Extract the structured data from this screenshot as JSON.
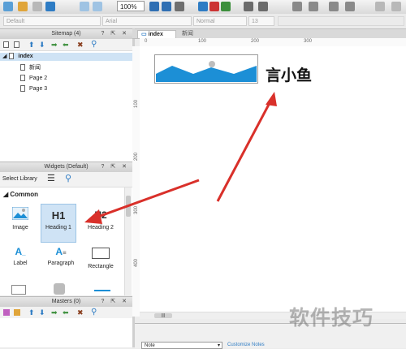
{
  "toolbar": {
    "zoom": "100%"
  },
  "format": {
    "style_value": "Default",
    "font_value": "Arial",
    "weight_value": "Normal",
    "size_value": "13"
  },
  "sitemap": {
    "title": "Sitemap (4)",
    "root": "index",
    "children": [
      "新闻",
      "Page 2",
      "Page 3"
    ]
  },
  "widgets_panel": {
    "title": "Widgets (Default)",
    "library_label": "Select Library",
    "section": "Common",
    "items": [
      {
        "label": "Image",
        "icon": "image-icon"
      },
      {
        "label": "Heading 1",
        "icon": "heading1-icon",
        "glyph": "H1"
      },
      {
        "label": "Heading 2",
        "icon": "heading2-icon",
        "glyph": "H2"
      },
      {
        "label": "Label",
        "icon": "label-icon",
        "glyph": "A"
      },
      {
        "label": "Paragraph",
        "icon": "paragraph-icon",
        "glyph": "A"
      },
      {
        "label": "Rectangle",
        "icon": "rectangle-icon"
      }
    ]
  },
  "masters": {
    "title": "Masters (0)"
  },
  "tabs": [
    {
      "label": "index",
      "active": true
    },
    {
      "label": "新闻",
      "active": false
    }
  ],
  "ruler": {
    "h_ticks": [
      "0",
      "100",
      "200",
      "300"
    ],
    "v_ticks": [
      "100",
      "200",
      "300",
      "400"
    ]
  },
  "canvas": {
    "heading_text": "言小鱼"
  },
  "note": {
    "dropdown": "Note",
    "link": "Customize Notes"
  },
  "watermark": "软件技巧",
  "colors": {
    "accent_blue": "#1c8fd6",
    "arrow_red": "#d9302a",
    "selection": "#cfe3f5"
  }
}
